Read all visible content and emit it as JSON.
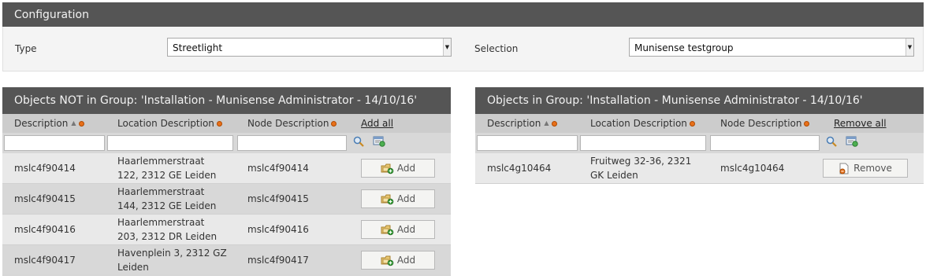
{
  "config": {
    "title": "Configuration",
    "type_label": "Type",
    "type_value": "Streetlight",
    "selection_label": "Selection",
    "selection_value": "Munisense testgroup"
  },
  "left_grid": {
    "title": "Objects NOT in Group: 'Installation - Munisense Administrator - 14/10/16'",
    "columns": {
      "description": "Description",
      "location": "Location Description",
      "node": "Node Description"
    },
    "bulk_action": "Add all",
    "rows": [
      {
        "description": "mslc4f90414",
        "location": "Haarlemmerstraat 122, 2312 GE Leiden",
        "node": "mslc4f90414",
        "action": "Add"
      },
      {
        "description": "mslc4f90415",
        "location": "Haarlemmerstraat 144, 2312 GE Leiden",
        "node": "mslc4f90415",
        "action": "Add"
      },
      {
        "description": "mslc4f90416",
        "location": "Haarlemmerstraat 203, 2312 DR Leiden",
        "node": "mslc4f90416",
        "action": "Add"
      },
      {
        "description": "mslc4f90417",
        "location": "Havenplein 3, 2312 GZ Leiden",
        "node": "mslc4f90417",
        "action": "Add"
      }
    ]
  },
  "right_grid": {
    "title": "Objects in Group: 'Installation - Munisense Administrator - 14/10/16'",
    "columns": {
      "description": "Description",
      "location": "Location Description",
      "node": "Node Description"
    },
    "bulk_action": "Remove all",
    "rows": [
      {
        "description": "mslc4g10464",
        "location": "Fruitweg 32-36, 2321 GK Leiden",
        "node": "mslc4g10464",
        "action": "Remove"
      }
    ]
  },
  "icons": {
    "sort": "sort-asc-icon",
    "filter_search": "magnifier-icon",
    "filter_clear": "clear-filter-icon",
    "add": "add-object-icon",
    "remove": "remove-object-icon"
  },
  "colors": {
    "header_bar": "#555555",
    "column_header": "#cccccc",
    "row_light": "#e9e9e9",
    "row_dark": "#d8d8d8",
    "status_dot": "#e8701a"
  }
}
